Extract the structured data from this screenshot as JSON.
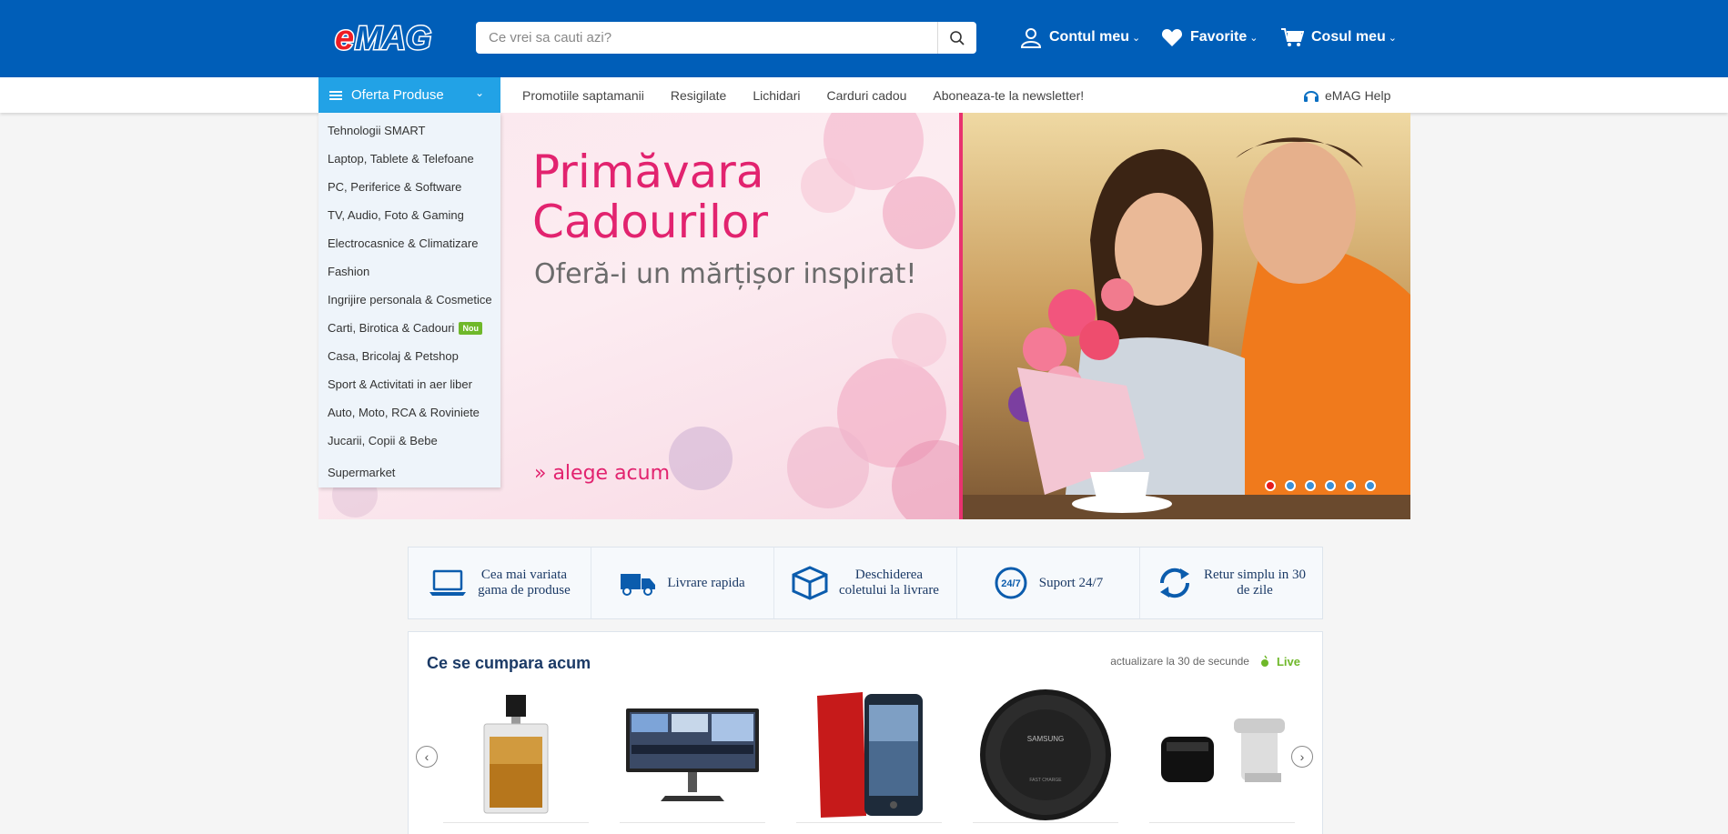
{
  "header": {
    "logo_text": "eMAG",
    "search_placeholder": "Ce vrei sa cauti azi?",
    "account_label": "Contul meu",
    "favorites_label": "Favorite",
    "cart_label": "Cosul meu",
    "caret": "⌄"
  },
  "nav": {
    "offer_label": "Oferta Produse",
    "links": [
      "Promotiile saptamanii",
      "Resigilate",
      "Lichidari",
      "Carduri cadou",
      "Aboneaza-te la newsletter!"
    ],
    "help_label": "eMAG Help"
  },
  "categories": [
    {
      "label": "Tehnologii SMART"
    },
    {
      "label": "Laptop, Tablete & Telefoane"
    },
    {
      "label": "PC, Periferice & Software"
    },
    {
      "label": "TV, Audio, Foto & Gaming"
    },
    {
      "label": "Electrocasnice & Climatizare"
    },
    {
      "label": "Fashion"
    },
    {
      "label": "Ingrijire personala & Cosmetice"
    },
    {
      "label": "Carti, Birotica & Cadouri",
      "badge": "Nou"
    },
    {
      "label": "Casa, Bricolaj & Petshop"
    },
    {
      "label": "Sport & Activitati in aer liber"
    },
    {
      "label": "Auto, Moto, RCA & Roviniete"
    },
    {
      "label": "Jucarii, Copii & Bebe"
    },
    {
      "label": "Supermarket"
    }
  ],
  "hero": {
    "title_line1": "Primăvara",
    "title_line2": "Cadourilor",
    "subtitle": "Oferă-i un mărțișor inspirat!",
    "cta": "» alege acum",
    "slide_count": 6,
    "active_slide": 1
  },
  "features": [
    {
      "icon": "laptop-icon",
      "line1": "Cea mai variata",
      "line2": "gama de produse"
    },
    {
      "icon": "truck-icon",
      "line1": "Livrare rapida",
      "line2": ""
    },
    {
      "icon": "box-icon",
      "line1": "Deschiderea",
      "line2": "coletului la livrare"
    },
    {
      "icon": "support-24-7-icon",
      "line1": "Suport 24/7",
      "line2": ""
    },
    {
      "icon": "return-arrows-icon",
      "line1": "Retur simplu in 30",
      "line2": "de zile"
    }
  ],
  "trending": {
    "title": "Ce se cumpara acum",
    "update_text": "actualizare la 30 de secunde",
    "live_label": "Live",
    "products": [
      "perfume-bottle-image",
      "monitor-image",
      "phone-case-image",
      "wireless-charger-image",
      "kitchen-appliances-image"
    ]
  },
  "colors": {
    "brand_blue": "#005eb8",
    "accent_blue": "#22a2e6",
    "pink": "#e2236f",
    "live_green": "#6fb82a"
  }
}
